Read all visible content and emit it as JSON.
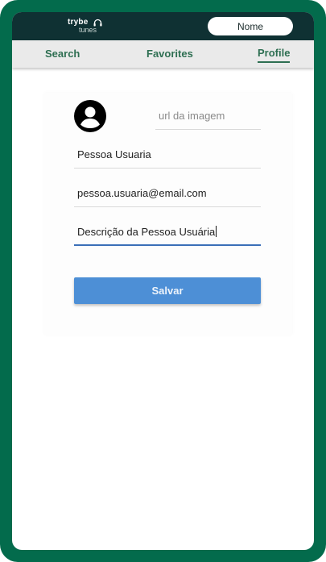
{
  "app": {
    "logo_line1": "trybe",
    "logo_line2": "tunes"
  },
  "header": {
    "user_name": "Nome"
  },
  "nav": {
    "search": "Search",
    "favorites": "Favorites",
    "profile": "Profile",
    "active": "Profile"
  },
  "profile_form": {
    "image_url_placeholder": "url da imagem",
    "name_value": "Pessoa Usuaria",
    "email_value": "pessoa.usuaria@email.com",
    "description_value": "Descrição da Pessoa Usuária",
    "save_label": "Salvar"
  },
  "colors": {
    "frame": "#036b4c",
    "topbar": "#0f3133",
    "nav_text": "#2e6f52",
    "save_button": "#4d8fd6",
    "focus_underline": "#3b6fb8"
  },
  "icons": {
    "logo": "headphones-icon",
    "avatar": "user-circle-icon"
  }
}
